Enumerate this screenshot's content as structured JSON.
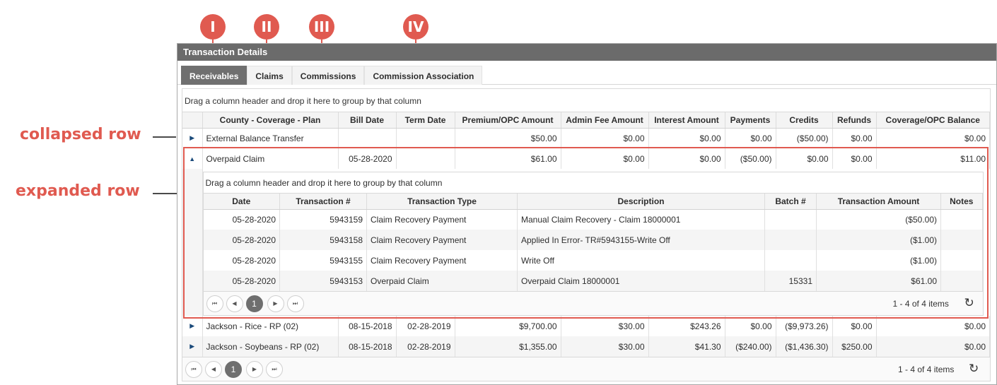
{
  "annotations": {
    "markers": [
      "I",
      "II",
      "III",
      "IV"
    ],
    "collapsed_label": "collapsed row",
    "expanded_label": "expanded row"
  },
  "panel": {
    "title": "Transaction Details",
    "tabs": [
      "Receivables",
      "Claims",
      "Commissions",
      "Commission Association"
    ],
    "group_hint": "Drag a column header and drop it here to group by that column"
  },
  "main_grid": {
    "columns": [
      "County - Coverage - Plan",
      "Bill Date",
      "Term Date",
      "Premium/OPC Amount",
      "Admin Fee Amount",
      "Interest Amount",
      "Payments",
      "Credits",
      "Refunds",
      "Coverage/OPC Balance"
    ],
    "rows": [
      [
        "External Balance Transfer",
        "",
        "",
        "$50.00",
        "$0.00",
        "$0.00",
        "$0.00",
        "($50.00)",
        "$0.00",
        "$0.00"
      ],
      [
        "Overpaid Claim",
        "05-28-2020",
        "",
        "$61.00",
        "$0.00",
        "$0.00",
        "($50.00)",
        "$0.00",
        "$0.00",
        "$11.00"
      ],
      [
        "Jackson - Rice - RP (02)",
        "08-15-2018",
        "02-28-2019",
        "$9,700.00",
        "$30.00",
        "$243.26",
        "$0.00",
        "($9,973.26)",
        "$0.00",
        "$0.00"
      ],
      [
        "Jackson - Soybeans - RP (02)",
        "08-15-2018",
        "02-28-2019",
        "$1,355.00",
        "$30.00",
        "$41.30",
        "($240.00)",
        "($1,436.30)",
        "$250.00",
        "$0.00"
      ]
    ],
    "pager": {
      "page": "1",
      "info": "1 - 4 of 4 items"
    }
  },
  "detail_grid": {
    "group_hint": "Drag a column header and drop it here to group by that column",
    "columns": [
      "Date",
      "Transaction #",
      "Transaction Type",
      "Description",
      "Batch #",
      "Transaction Amount",
      "Notes"
    ],
    "rows": [
      [
        "05-28-2020",
        "5943159",
        "Claim Recovery Payment",
        "Manual Claim Recovery - Claim 18000001",
        "",
        "($50.00)",
        ""
      ],
      [
        "05-28-2020",
        "5943158",
        "Claim Recovery Payment",
        "Applied In Error- TR#5943155-Write Off",
        "",
        "($1.00)",
        ""
      ],
      [
        "05-28-2020",
        "5943155",
        "Claim Recovery Payment",
        "Write Off",
        "",
        "($1.00)",
        ""
      ],
      [
        "05-28-2020",
        "5943153",
        "Overpaid Claim",
        "Overpaid Claim 18000001",
        "15331",
        "$61.00",
        ""
      ]
    ],
    "pager": {
      "page": "1",
      "info": "1 - 4 of 4 items"
    }
  },
  "colors": {
    "accent": "#e05a50",
    "header_bg": "#6b6b6b",
    "active_tab": "#6f6f6f"
  }
}
